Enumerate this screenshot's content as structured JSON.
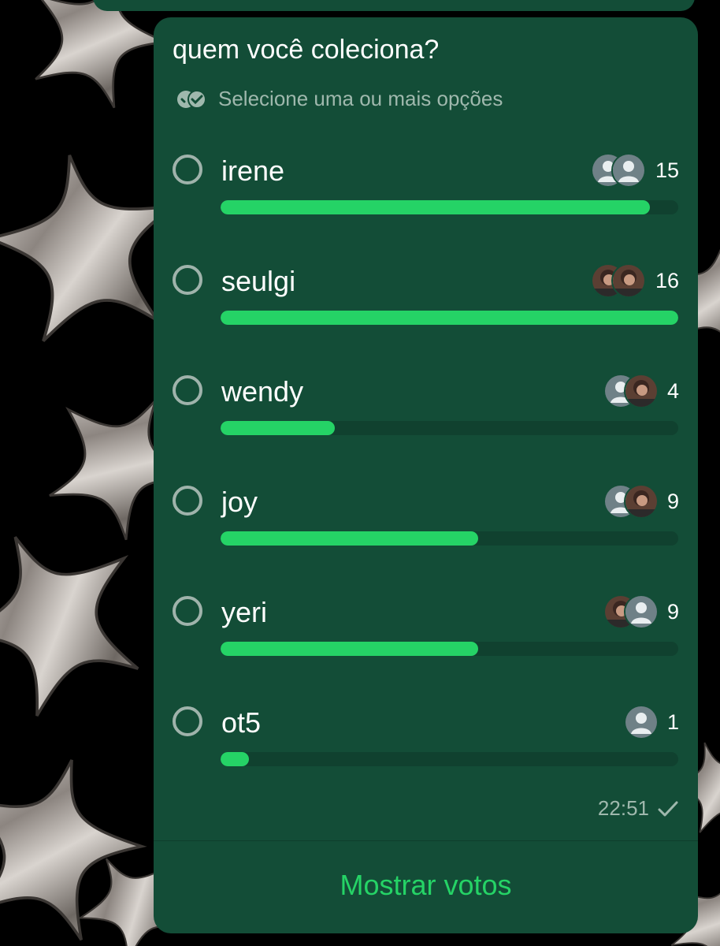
{
  "poll": {
    "question": "quem você coleciona?",
    "hint": "Selecione uma ou mais opções",
    "max_votes": 16,
    "options": [
      {
        "label": "irene",
        "votes": "15",
        "avatars": [
          "default-avatar-icon",
          "default-avatar-icon"
        ]
      },
      {
        "label": "seulgi",
        "votes": "16",
        "avatars": [
          "photo-avatar",
          "photo-avatar"
        ]
      },
      {
        "label": "wendy",
        "votes": "4",
        "avatars": [
          "default-avatar-icon",
          "photo-avatar"
        ]
      },
      {
        "label": "joy",
        "votes": "9",
        "avatars": [
          "default-avatar-icon",
          "photo-avatar"
        ]
      },
      {
        "label": "yeri",
        "votes": "9",
        "avatars": [
          "photo-avatar",
          "default-avatar-icon"
        ]
      },
      {
        "label": "ot5",
        "votes": "1",
        "avatars": [
          "default-avatar-icon"
        ]
      }
    ],
    "time": "22:51",
    "status_icon": "single-check-icon",
    "action_label": "Mostrar votos"
  },
  "colors": {
    "bubble": "#134d37",
    "bar_fill": "#25d366",
    "bar_track": "#10412f",
    "secondary_text": "#9fb8ad",
    "action": "#25d366"
  }
}
